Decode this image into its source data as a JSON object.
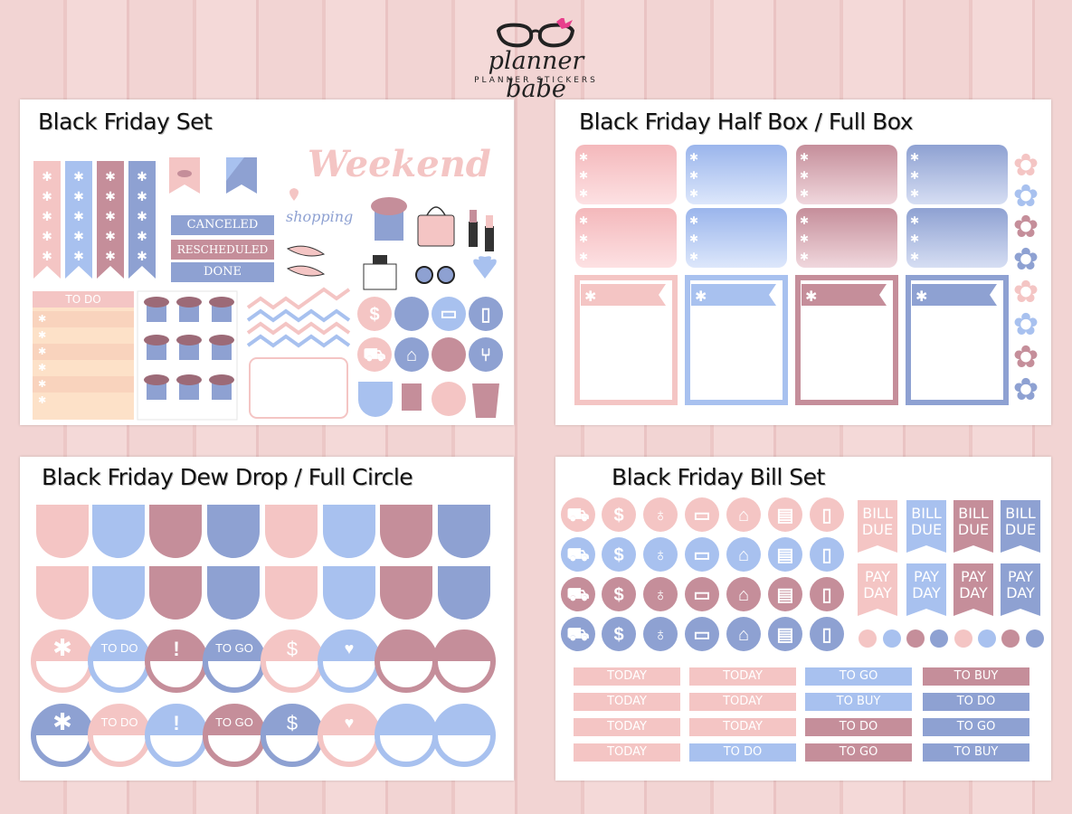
{
  "logo": {
    "name": "planner babe",
    "tagline": "PLANNER STICKERS"
  },
  "colors": {
    "pink": "#f4c5c4",
    "blue": "#a8c1ef",
    "mauve": "#c58e9a",
    "slate": "#8ea1d2",
    "peach": "#fde1c8"
  },
  "panels": {
    "set": {
      "title": "Black Friday Set"
    },
    "box": {
      "title": "Black Friday Half Box / Full Box"
    },
    "drop": {
      "title": "Black Friday Dew Drop / Full Circle"
    },
    "bill": {
      "title": "Black Friday Bill Set"
    }
  },
  "set_stickers": {
    "weekend": "Weekend",
    "shopping": "shopping",
    "todo": "TO DO",
    "labels": [
      "CANCELED",
      "RESCHEDULED",
      "DONE"
    ]
  },
  "circle_labels": {
    "row1": [
      "*",
      "TO DO",
      "!",
      "TO GO",
      "$",
      "heart",
      "",
      ""
    ],
    "row2": [
      "*",
      "TO DO",
      "!",
      "TO GO",
      "$",
      "heart",
      "",
      ""
    ]
  },
  "bill_flags": {
    "top": [
      "BILL DUE",
      "BILL DUE",
      "BILL DUE",
      "BILL DUE"
    ],
    "bottom": [
      "PAY DAY",
      "PAY DAY",
      "PAY DAY",
      "PAY DAY"
    ]
  },
  "bill_icons": [
    "car-icon",
    "dollar-icon",
    "lightbulb-icon",
    "laptop-icon",
    "house-icon",
    "cash-icon",
    "phone-icon"
  ],
  "bill_labels": [
    [
      "TODAY",
      "TODAY",
      "TO GO",
      "TO BUY"
    ],
    [
      "TODAY",
      "TODAY",
      "TO BUY",
      "TO DO"
    ],
    [
      "TODAY",
      "TODAY",
      "TO DO",
      "TO GO"
    ],
    [
      "TODAY",
      "TO DO",
      "TO GO",
      "TO BUY"
    ]
  ]
}
